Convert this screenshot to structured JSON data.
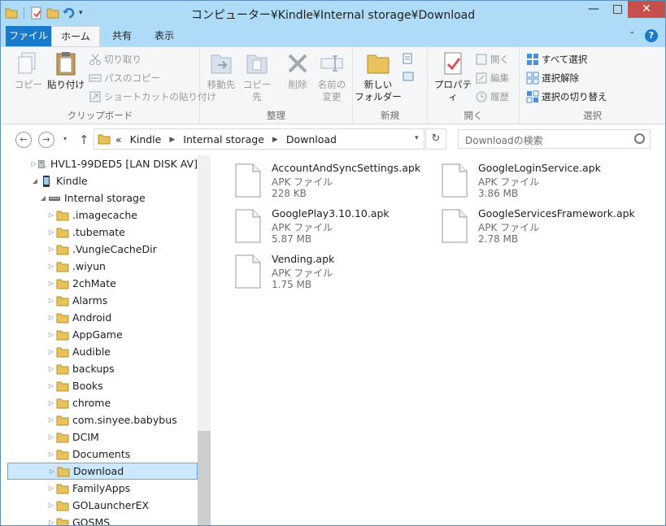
{
  "window": {
    "title": "コンピューター¥Kindle¥Internal storage¥Download",
    "minimize_glyph": "—",
    "maximize_glyph": "□",
    "close_glyph": "✕"
  },
  "ribbon_tabs": {
    "file": "ファイル",
    "home": "ホーム",
    "share": "共有",
    "view": "表示",
    "collapse_glyph": "⌃",
    "help_glyph": "?"
  },
  "clipboard": {
    "copy": "コピー",
    "paste": "貼り付け",
    "cut": "切り取り",
    "copy_path": "パスのコピー",
    "paste_shortcut": "ショートカットの貼り付け",
    "label": "クリップボード"
  },
  "organize": {
    "move_to": "移動先",
    "copy_to": "コピー先",
    "delete": "削除",
    "rename_line1": "名前の",
    "rename_line2": "変更",
    "label": "整理"
  },
  "new": {
    "new_folder_line1": "新しい",
    "new_folder_line2": "フォルダー",
    "label": "新規"
  },
  "open": {
    "properties": "プロパティ",
    "open": "開く",
    "edit": "編集",
    "history": "履歴",
    "label": "開く"
  },
  "select": {
    "select_all": "すべて選択",
    "select_none": "選択解除",
    "invert": "選択の切り替え",
    "label": "選択"
  },
  "address": {
    "back_glyph": "←",
    "forward_glyph": "→",
    "up_glyph": "↑",
    "chevrons": "«",
    "crumbs": [
      "Kindle",
      "Internal storage",
      "Download"
    ],
    "crumb_sep": "▶",
    "dropdown_glyph": "▾",
    "refresh_glyph": "↻",
    "search_placeholder": "Downloadの検索"
  },
  "nav_tree": [
    {
      "label": "HVL1-99DED5 [LAN DISK AV]",
      "icon": "network-drive-icon",
      "arrow": "▷"
    },
    {
      "label": "Kindle",
      "icon": "device-icon",
      "arrow": "◢"
    },
    {
      "label": "Internal storage",
      "icon": "storage-icon",
      "arrow": "◢"
    },
    {
      "label": ".imagecache",
      "icon": "folder-icon",
      "arrow": "▷"
    },
    {
      "label": ".tubemate",
      "icon": "folder-icon",
      "arrow": "▷"
    },
    {
      "label": ".VungleCacheDir",
      "icon": "folder-icon",
      "arrow": "▷"
    },
    {
      "label": ".wiyun",
      "icon": "folder-icon",
      "arrow": "▷"
    },
    {
      "label": "2chMate",
      "icon": "folder-icon",
      "arrow": "▷"
    },
    {
      "label": "Alarms",
      "icon": "folder-icon",
      "arrow": "▷"
    },
    {
      "label": "Android",
      "icon": "folder-icon",
      "arrow": "▷"
    },
    {
      "label": "AppGame",
      "icon": "folder-icon",
      "arrow": "▷"
    },
    {
      "label": "Audible",
      "icon": "folder-icon",
      "arrow": "▷"
    },
    {
      "label": "backups",
      "icon": "folder-icon",
      "arrow": "▷"
    },
    {
      "label": "Books",
      "icon": "folder-icon",
      "arrow": "▷"
    },
    {
      "label": "chrome",
      "icon": "folder-icon",
      "arrow": "▷"
    },
    {
      "label": "com.sinyee.babybus",
      "icon": "folder-icon",
      "arrow": "▷"
    },
    {
      "label": "DCIM",
      "icon": "folder-icon",
      "arrow": "▷"
    },
    {
      "label": "Documents",
      "icon": "folder-icon",
      "arrow": "▷"
    },
    {
      "label": "Download",
      "icon": "folder-icon",
      "arrow": "▷",
      "selected": true
    },
    {
      "label": "FamilyApps",
      "icon": "folder-icon",
      "arrow": "▷"
    },
    {
      "label": "GOLauncherEX",
      "icon": "folder-icon",
      "arrow": "▷"
    },
    {
      "label": "GOSMS",
      "icon": "folder-icon",
      "arrow": "▷"
    }
  ],
  "files": [
    {
      "name": "AccountAndSyncSettings.apk",
      "type": "APK ファイル",
      "size": "228 KB"
    },
    {
      "name": "GoogleLoginService.apk",
      "type": "APK ファイル",
      "size": "3.86 MB"
    },
    {
      "name": "GooglePlay3.10.10.apk",
      "type": "APK ファイル",
      "size": "5.87 MB"
    },
    {
      "name": "GoogleServicesFramework.apk",
      "type": "APK ファイル",
      "size": "2.78 MB"
    },
    {
      "name": "Vending.apk",
      "type": "APK ファイル",
      "size": "1.75 MB"
    }
  ],
  "colors": {
    "titlebar": "#aedcf8",
    "file_tab": "#1979ca",
    "selection": "#cce8ff",
    "folder": "#e8c25a"
  }
}
